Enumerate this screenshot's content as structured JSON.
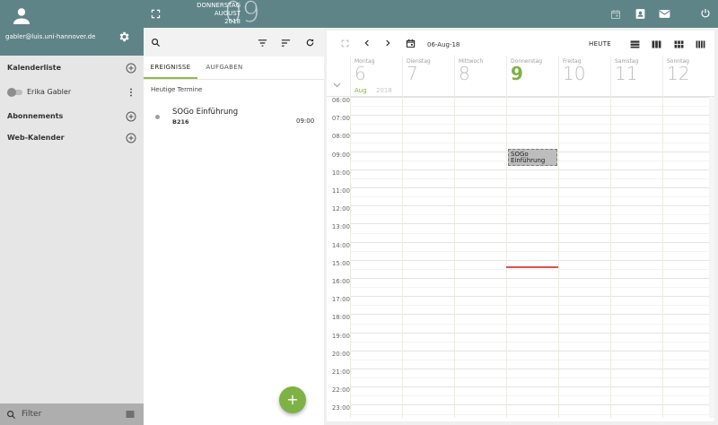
{
  "sidebar": {
    "user_email": "gabler@luis.uni-hannover.de",
    "calendar_list_label": "Kalenderliste",
    "calendars": [
      {
        "name": "Erika Gabler",
        "enabled": false
      }
    ],
    "subscriptions_label": "Abonnements",
    "web_calendar_label": "Web-Kalender",
    "filter_placeholder": "Filter"
  },
  "topbar": {
    "weekday": "DONNERSTAG",
    "month": "AUGUST",
    "year": "2018",
    "day": "09",
    "apps": [
      "calendar-icon",
      "contacts-icon",
      "mail-icon",
      "power-icon"
    ]
  },
  "list_panel": {
    "tabs": [
      {
        "label": "EREIGNISSE",
        "active": true
      },
      {
        "label": "AUFGABEN",
        "active": false
      }
    ],
    "today_heading": "Heutige Termine",
    "events": [
      {
        "title": "SOGo Einführung",
        "location": "B216",
        "time": "09:00"
      }
    ]
  },
  "calendar": {
    "date_label": "06-Aug-18",
    "today_label": "HEUTE",
    "month_label": "Aug",
    "year_label": "2018",
    "days": [
      {
        "weekday": "Montag",
        "day": "6",
        "today": false
      },
      {
        "weekday": "Dienstag",
        "day": "7",
        "today": false
      },
      {
        "weekday": "Mittwoch",
        "day": "8",
        "today": false
      },
      {
        "weekday": "Donnerstag",
        "day": "9",
        "today": true
      },
      {
        "weekday": "Freitag",
        "day": "10",
        "today": false
      },
      {
        "weekday": "Samstag",
        "day": "11",
        "today": false
      },
      {
        "weekday": "Sonntag",
        "day": "12",
        "today": false
      }
    ],
    "hours": [
      "06:00",
      "07:00",
      "08:00",
      "09:00",
      "10:00",
      "11:00",
      "12:00",
      "13:00",
      "14:00",
      "15:00",
      "16:00",
      "17:00",
      "18:00",
      "19:00",
      "20:00",
      "21:00",
      "22:00",
      "23:00"
    ],
    "grid_events": [
      {
        "title": "SOGo Einführung",
        "day_index": 3,
        "start": "09:00",
        "end": "10:00"
      }
    ],
    "now_time": "15:15"
  },
  "colors": {
    "header": "#5f8487",
    "accent": "#7fb245",
    "now_line": "#e05050"
  }
}
